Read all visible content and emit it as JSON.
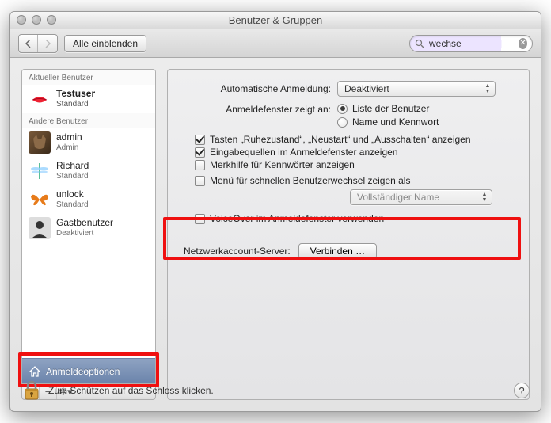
{
  "window": {
    "title": "Benutzer & Gruppen"
  },
  "toolbar": {
    "show_all": "Alle einblenden",
    "search_value": "wechse"
  },
  "sidebar": {
    "group_current": "Aktueller Benutzer",
    "group_others": "Andere Benutzer",
    "users": [
      {
        "name": "Testuser",
        "role": "Standard",
        "avatar": "lips"
      },
      {
        "name": "admin",
        "role": "Admin",
        "avatar": "cat"
      },
      {
        "name": "Richard",
        "role": "Standard",
        "avatar": "dragonfly"
      },
      {
        "name": "unlock",
        "role": "Standard",
        "avatar": "butterfly"
      },
      {
        "name": "Gastbenutzer",
        "role": "Deaktiviert",
        "avatar": "silhouette"
      }
    ],
    "login_options": "Anmeldeoptionen"
  },
  "panel": {
    "auto_login_label": "Automatische Anmeldung:",
    "auto_login_value": "Deaktiviert",
    "login_window_label": "Anmeldefenster zeigt an:",
    "radio_list": "Liste der Benutzer",
    "radio_namepw": "Name und Kennwort",
    "chk_buttons": "Tasten „Ruhezustand“, „Neustart“ und „Ausschalten“ anzeigen",
    "chk_input": "Eingabequellen im Anmeldefenster anzeigen",
    "chk_hints": "Merkhilfe für Kennwörter anzeigen",
    "chk_fast": "Menü für schnellen Benutzerwechsel zeigen als",
    "fast_popup": "Vollständiger Name",
    "chk_voiceover": "VoiceOver im Anmeldefenster verwenden",
    "net_label": "Netzwerkaccount-Server:",
    "net_button": "Verbinden …"
  },
  "footer": {
    "lock_text": "Zum Schützen auf das Schloss klicken."
  }
}
